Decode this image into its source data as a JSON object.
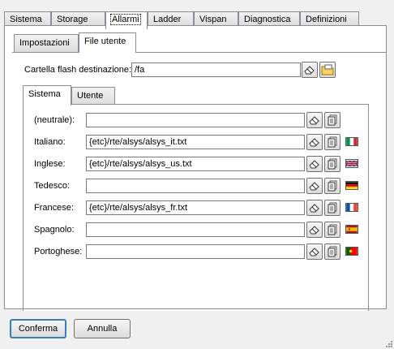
{
  "main_tabs": [
    {
      "label": "Sistema"
    },
    {
      "label": "Storage"
    },
    {
      "label": "Allarmi"
    },
    {
      "label": "Ladder"
    },
    {
      "label": "Vispan"
    },
    {
      "label": "Diagnostica"
    },
    {
      "label": "Definizioni"
    }
  ],
  "sub_tabs": [
    {
      "label": "Impostazioni"
    },
    {
      "label": "File utente"
    }
  ],
  "destination": {
    "label": "Cartella flash destinazione:",
    "value": "/fa"
  },
  "lang_tabs": [
    {
      "label": "Sistema"
    },
    {
      "label": "Utente"
    }
  ],
  "languages": [
    {
      "label": "(neutrale):",
      "value": "",
      "flag": ""
    },
    {
      "label": "Italiano:",
      "value": "{etc}/rte/alsys/alsys_it.txt",
      "flag": "italy-flag"
    },
    {
      "label": "Inglese:",
      "value": "{etc}/rte/alsys/alsys_us.txt",
      "flag": "uk-flag"
    },
    {
      "label": "Tedesco:",
      "value": "",
      "flag": "germany-flag"
    },
    {
      "label": "Francese:",
      "value": "{etc}/rte/alsys/alsys_fr.txt",
      "flag": "france-flag"
    },
    {
      "label": "Spagnolo:",
      "value": "",
      "flag": "spain-flag"
    },
    {
      "label": "Portoghese:",
      "value": "",
      "flag": "portugal-flag"
    }
  ],
  "buttons": {
    "confirm": "Conferma",
    "cancel": "Annulla"
  }
}
